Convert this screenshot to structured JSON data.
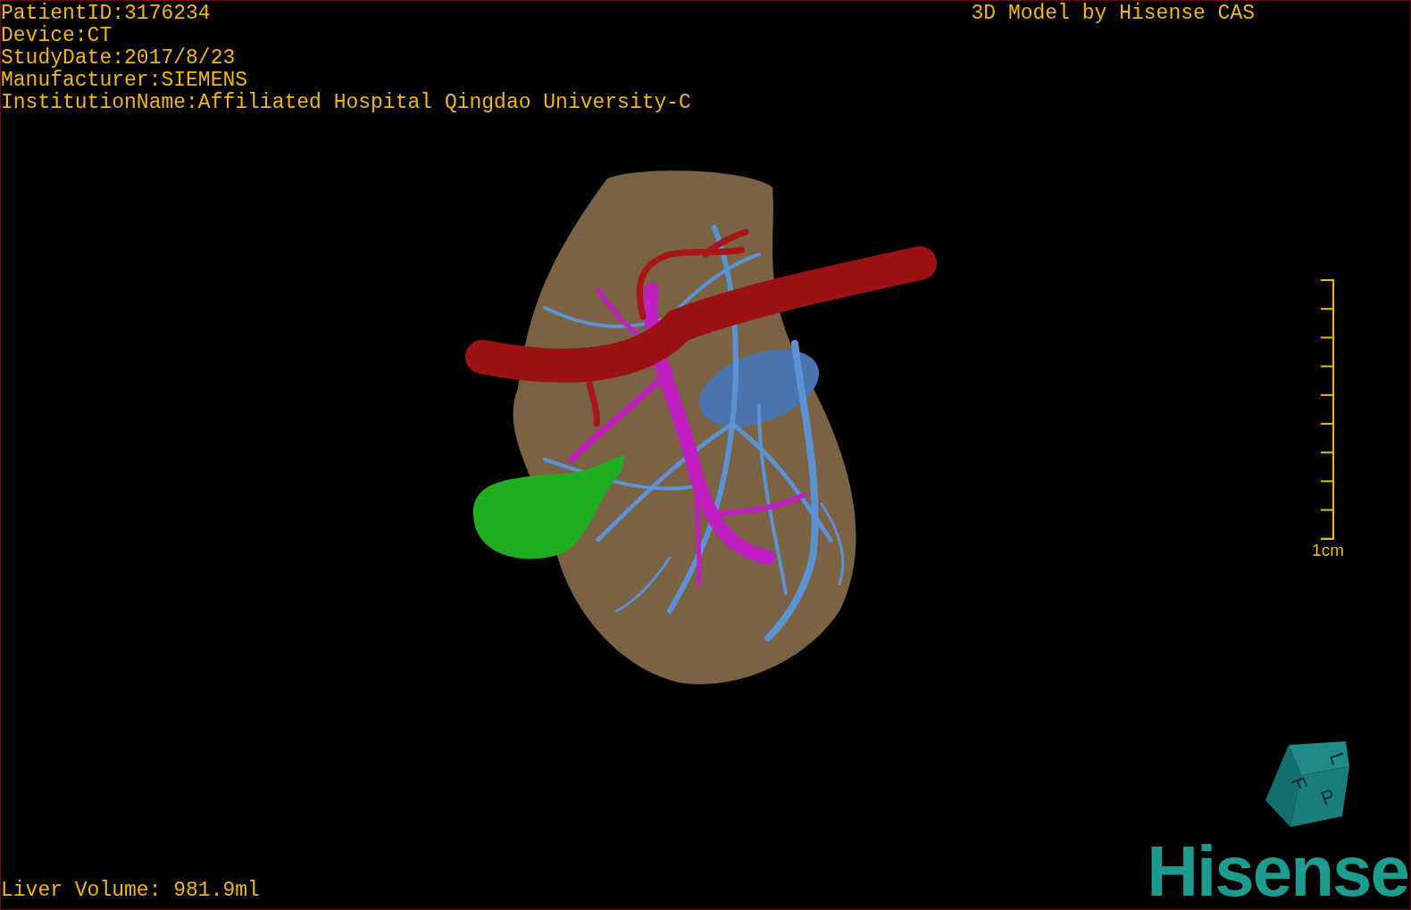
{
  "study_info": [
    "PatientID:3176234",
    "Device:CT",
    "StudyDate:2017/8/23",
    "Manufacturer:SIEMENS",
    "InstitutionName:Affiliated Hospital Qingdao University-C"
  ],
  "title": "3D Model by Hisense CAS",
  "scale_bar": {
    "label": "1cm"
  },
  "liver_volume": "Liver Volume: 981.9ml",
  "orientation_cube": {
    "labels": [
      "F",
      "L",
      "P"
    ]
  },
  "logo": "Hisense"
}
